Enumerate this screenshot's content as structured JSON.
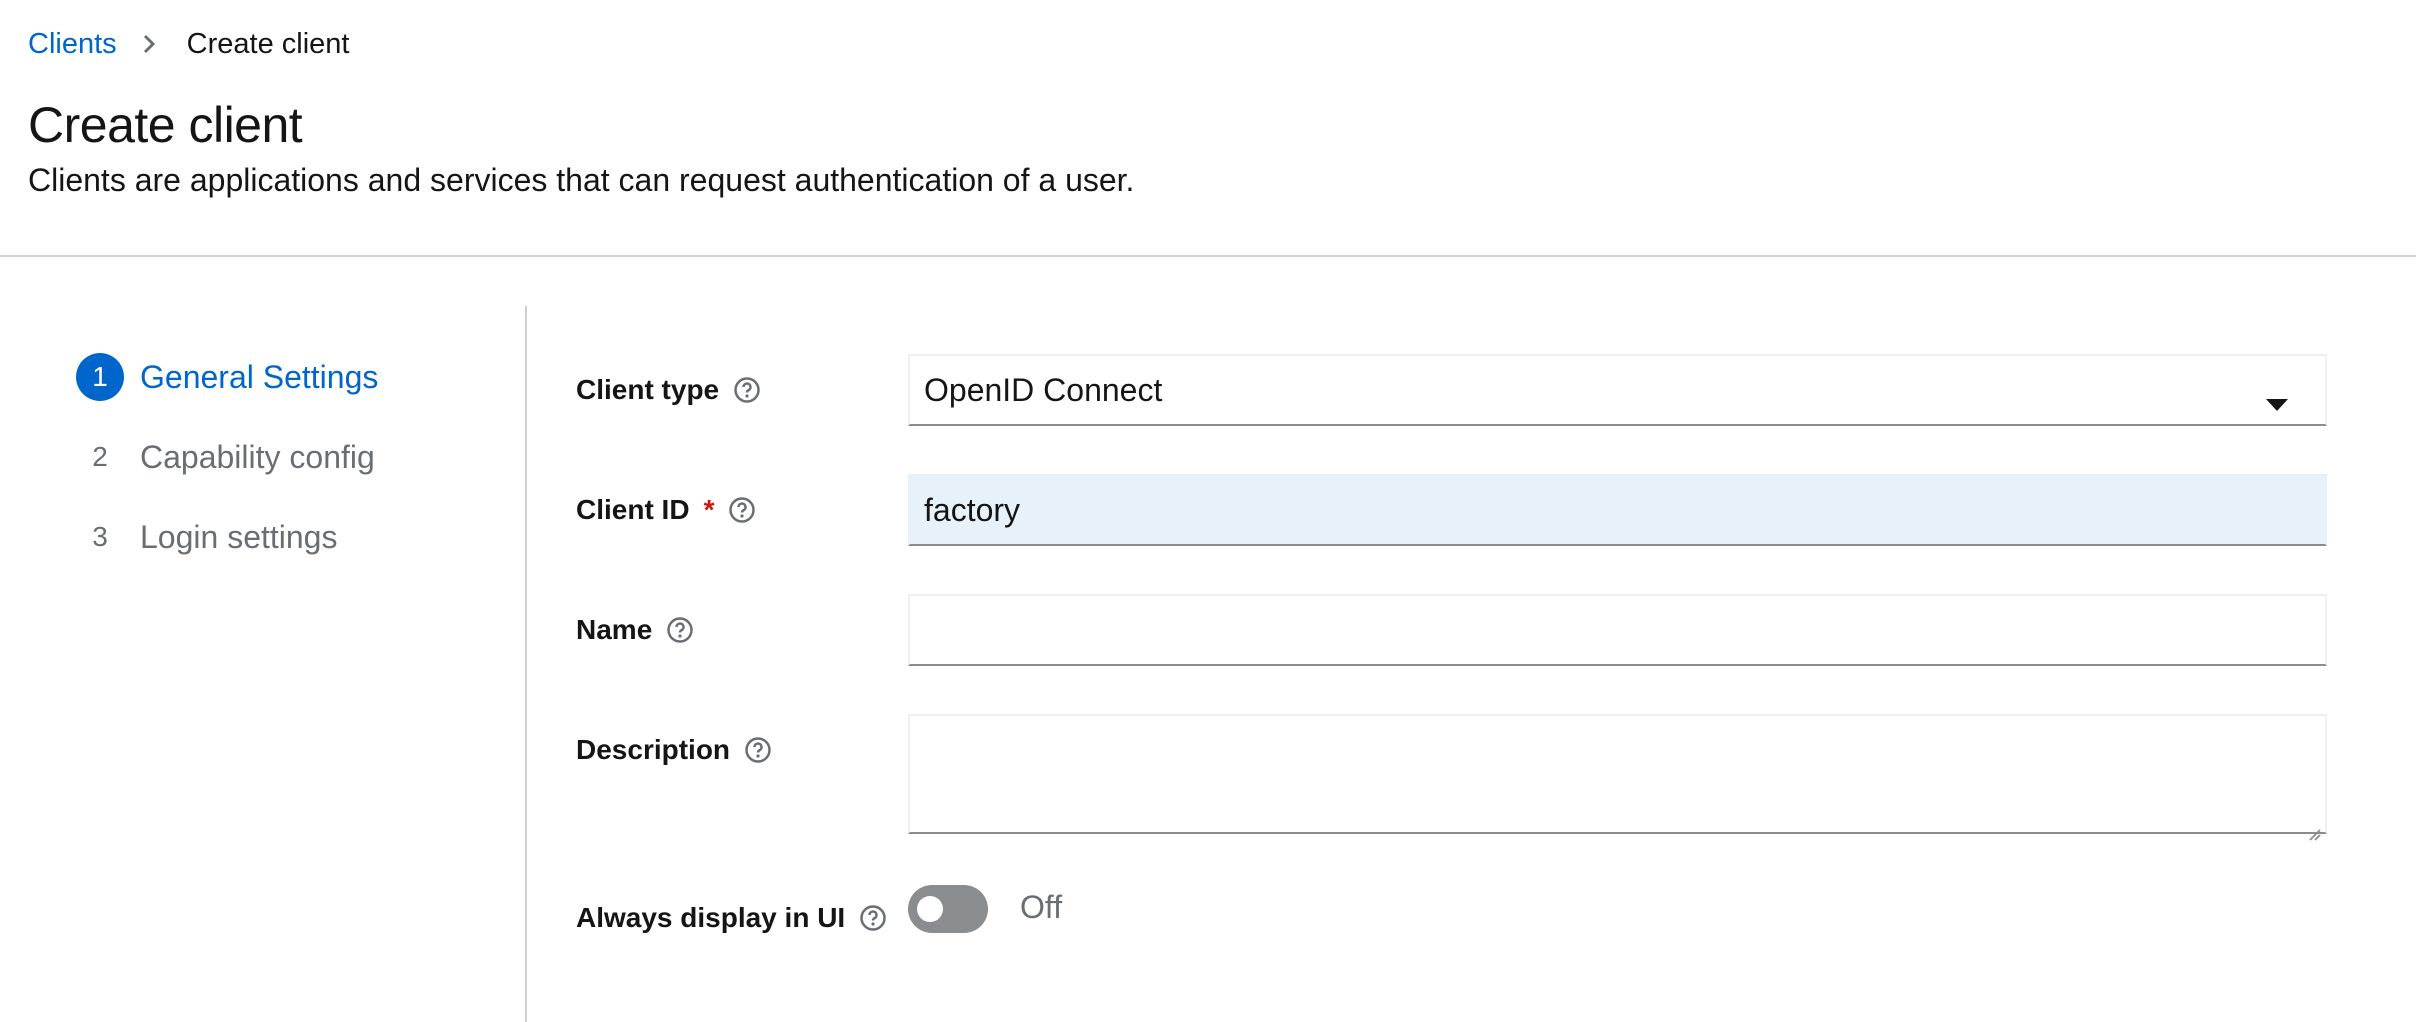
{
  "breadcrumb": {
    "parent": "Clients",
    "current": "Create client"
  },
  "page": {
    "title": "Create client",
    "description": "Clients are applications and services that can request authentication of a user."
  },
  "wizard": {
    "steps": [
      {
        "number": "1",
        "label": "General Settings",
        "active": true
      },
      {
        "number": "2",
        "label": "Capability config",
        "active": false
      },
      {
        "number": "3",
        "label": "Login settings",
        "active": false
      }
    ]
  },
  "form": {
    "client_type": {
      "label": "Client type",
      "value": "OpenID Connect"
    },
    "client_id": {
      "label": "Client ID",
      "required_mark": "*",
      "value": "factory"
    },
    "name": {
      "label": "Name",
      "value": ""
    },
    "description": {
      "label": "Description",
      "value": ""
    },
    "always_display": {
      "label": "Always display in UI",
      "state_text": "Off",
      "enabled": false
    }
  },
  "colors": {
    "accent": "#0066cc",
    "required": "#c9190b",
    "filled_field": "#e7f1fa",
    "toggle_off": "#8a8d90"
  },
  "icons": {
    "breadcrumb_separator": "chevron-right-icon",
    "help": "question-circle-icon",
    "select": "caret-down-icon"
  }
}
